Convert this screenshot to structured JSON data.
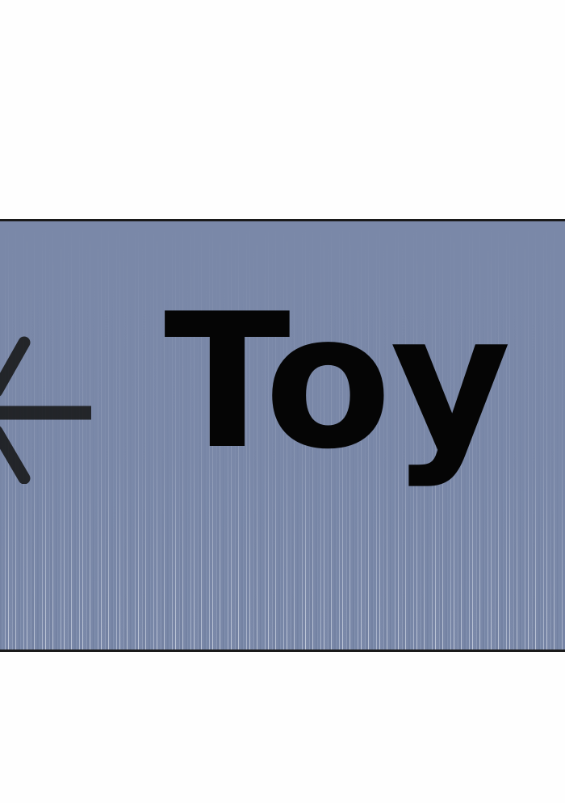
{
  "panel": {
    "text": "Toy",
    "icon": "arrow-left-icon",
    "colors": {
      "background": "#7a88a8",
      "speed_lines": "#e6ebf4",
      "text": "#050505",
      "border": "#1a1a1a"
    }
  }
}
